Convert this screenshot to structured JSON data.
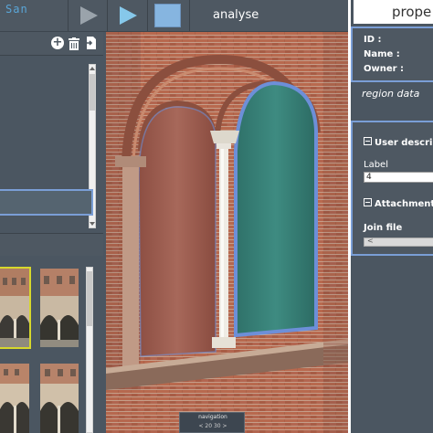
{
  "app": {
    "title": "San"
  },
  "toolbar": {
    "mode_label": "analyse",
    "tools": [
      "select-tool-icon",
      "play-tool-icon",
      "rectangle-tool-icon"
    ]
  },
  "left_panel": {
    "header_icons": [
      "add-icon",
      "trash-icon",
      "export-icon"
    ],
    "thumbnails": [
      "courtyard-arcade-1",
      "courtyard-arcade-2",
      "courtyard-arcade-3",
      "courtyard-arcade-4"
    ]
  },
  "navigation": {
    "title": "navigation",
    "ticks": "< 20  30  >"
  },
  "properties": {
    "title": "prope",
    "id_label": "ID :",
    "name_label": "Name :",
    "owner_label": "Owner :",
    "region_data": "region data",
    "user_desc_section": "User descri",
    "label_field_label": "Label",
    "label_value": "4",
    "attachment_section": "Attachment",
    "join_file_label": "Join file",
    "join_file_arrow": "<"
  },
  "colors": {
    "panel_bg": "#4b5661",
    "selection_blue": "#7a9ed6",
    "thumb_selected": "#d7d82c",
    "region_outline": "#6d8fd8"
  }
}
